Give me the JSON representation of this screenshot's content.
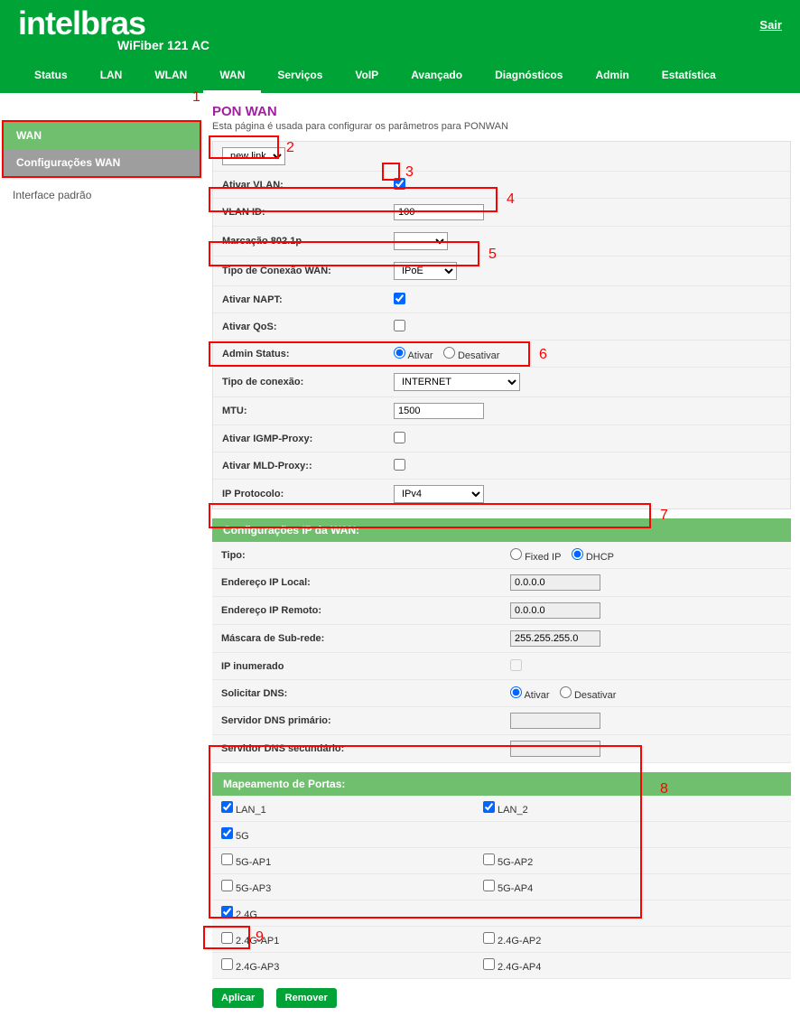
{
  "header": {
    "brand": "intelbras",
    "model": "WiFiber 121 AC",
    "exit": "Sair"
  },
  "nav": [
    "Status",
    "LAN",
    "WLAN",
    "WAN",
    "Serviços",
    "VoIP",
    "Avançado",
    "Diagnósticos",
    "Admin",
    "Estatística"
  ],
  "nav_active": "WAN",
  "sidebar": {
    "items": [
      "WAN",
      "Configurações WAN",
      "Interface padrão"
    ]
  },
  "page": {
    "title": "PON WAN",
    "desc": "Esta página é usada para configurar os parâmetros para PONWAN"
  },
  "form": {
    "link_select": "new link",
    "ativar_vlan_label": "Ativar VLAN:",
    "ativar_vlan_checked": true,
    "vlan_id_label": "VLAN ID:",
    "vlan_id_value": "100",
    "marcacao_label": "Marcação 802.1p",
    "marcacao_value": "",
    "tipo_wan_label": "Tipo de Conexão WAN:",
    "tipo_wan_value": "IPoE",
    "napt_label": "Ativar NAPT:",
    "napt_checked": true,
    "qos_label": "Ativar QoS:",
    "qos_checked": false,
    "admin_label": "Admin Status:",
    "admin_opt1": "Ativar",
    "admin_opt2": "Desativar",
    "tipo_conexao_label": "Tipo de conexão:",
    "tipo_conexao_value": "INTERNET",
    "mtu_label": "MTU:",
    "mtu_value": "1500",
    "igmp_label": "Ativar IGMP-Proxy:",
    "igmp_checked": false,
    "mld_label": "Ativar MLD-Proxy::",
    "mld_checked": false,
    "ipproto_label": "IP Protocolo:",
    "ipproto_value": "IPv4"
  },
  "ipwan": {
    "header": "Configurações IP da WAN:",
    "tipo_label": "Tipo:",
    "tipo_opt1": "Fixed IP",
    "tipo_opt2": "DHCP",
    "local_label": "Endereço IP Local:",
    "local_value": "0.0.0.0",
    "remoto_label": "Endereço IP Remoto:",
    "remoto_value": "0.0.0.0",
    "mask_label": "Máscara de Sub-rede:",
    "mask_value": "255.255.255.0",
    "inum_label": "IP inumerado",
    "inum_checked": false,
    "dns_label": "Solicitar DNS:",
    "dns_opt1": "Ativar",
    "dns_opt2": "Desativar",
    "dns1_label": "Servidor DNS primário:",
    "dns1_value": "",
    "dns2_label": "Servidor DNS secundário:",
    "dns2_value": ""
  },
  "ports": {
    "header": "Mapeamento de Portas:",
    "rows": [
      {
        "l": "LAN_1",
        "lc": true,
        "r": "LAN_2",
        "rc": true
      },
      {
        "l": "5G",
        "lc": true,
        "r": "",
        "rc": null
      },
      {
        "l": "5G-AP1",
        "lc": false,
        "r": "5G-AP2",
        "rc": false
      },
      {
        "l": "5G-AP3",
        "lc": false,
        "r": "5G-AP4",
        "rc": false
      },
      {
        "l": "2.4G",
        "lc": true,
        "r": "",
        "rc": null
      },
      {
        "l": "2.4G-AP1",
        "lc": false,
        "r": "2.4G-AP2",
        "rc": false
      },
      {
        "l": "2.4G-AP3",
        "lc": false,
        "r": "2.4G-AP4",
        "rc": false
      }
    ]
  },
  "buttons": {
    "apply": "Aplicar",
    "remove": "Remover"
  },
  "annotations": [
    "1",
    "2",
    "3",
    "4",
    "5",
    "6",
    "7",
    "8",
    "9"
  ]
}
